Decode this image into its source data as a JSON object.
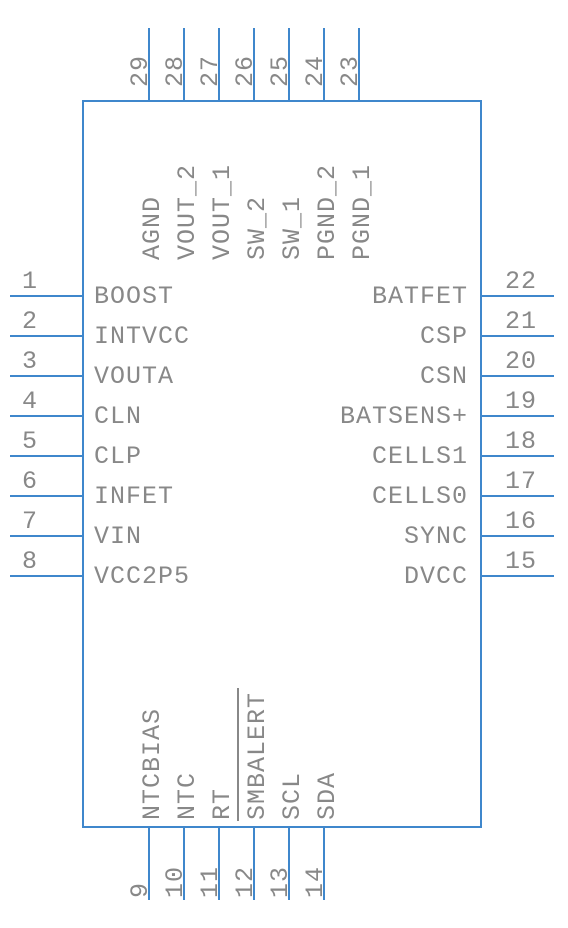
{
  "pins": {
    "left": [
      {
        "num": "1",
        "name": "BOOST"
      },
      {
        "num": "2",
        "name": "INTVCC"
      },
      {
        "num": "3",
        "name": "VOUTA"
      },
      {
        "num": "4",
        "name": "CLN"
      },
      {
        "num": "5",
        "name": "CLP"
      },
      {
        "num": "6",
        "name": "INFET"
      },
      {
        "num": "7",
        "name": "VIN"
      },
      {
        "num": "8",
        "name": "VCC2P5"
      }
    ],
    "right": [
      {
        "num": "22",
        "name": "BATFET"
      },
      {
        "num": "21",
        "name": "CSP"
      },
      {
        "num": "20",
        "name": "CSN"
      },
      {
        "num": "19",
        "name": "BATSENS+"
      },
      {
        "num": "18",
        "name": "CELLS1"
      },
      {
        "num": "17",
        "name": "CELLS0"
      },
      {
        "num": "16",
        "name": "SYNC"
      },
      {
        "num": "15",
        "name": "DVCC"
      }
    ],
    "top": [
      {
        "num": "29",
        "name": "AGND"
      },
      {
        "num": "28",
        "name": "VOUT_2"
      },
      {
        "num": "27",
        "name": "VOUT_1"
      },
      {
        "num": "26",
        "name": "SW_2"
      },
      {
        "num": "25",
        "name": "SW_1"
      },
      {
        "num": "24",
        "name": "PGND_2"
      },
      {
        "num": "23",
        "name": "PGND_1"
      }
    ],
    "bottom": [
      {
        "num": "9",
        "name": "NTCBIAS"
      },
      {
        "num": "10",
        "name": "NTC"
      },
      {
        "num": "11",
        "name": "RT"
      },
      {
        "num": "12",
        "name": "SMBALERT"
      },
      {
        "num": "13",
        "name": "SCL"
      },
      {
        "num": "14",
        "name": "SDA"
      }
    ]
  }
}
